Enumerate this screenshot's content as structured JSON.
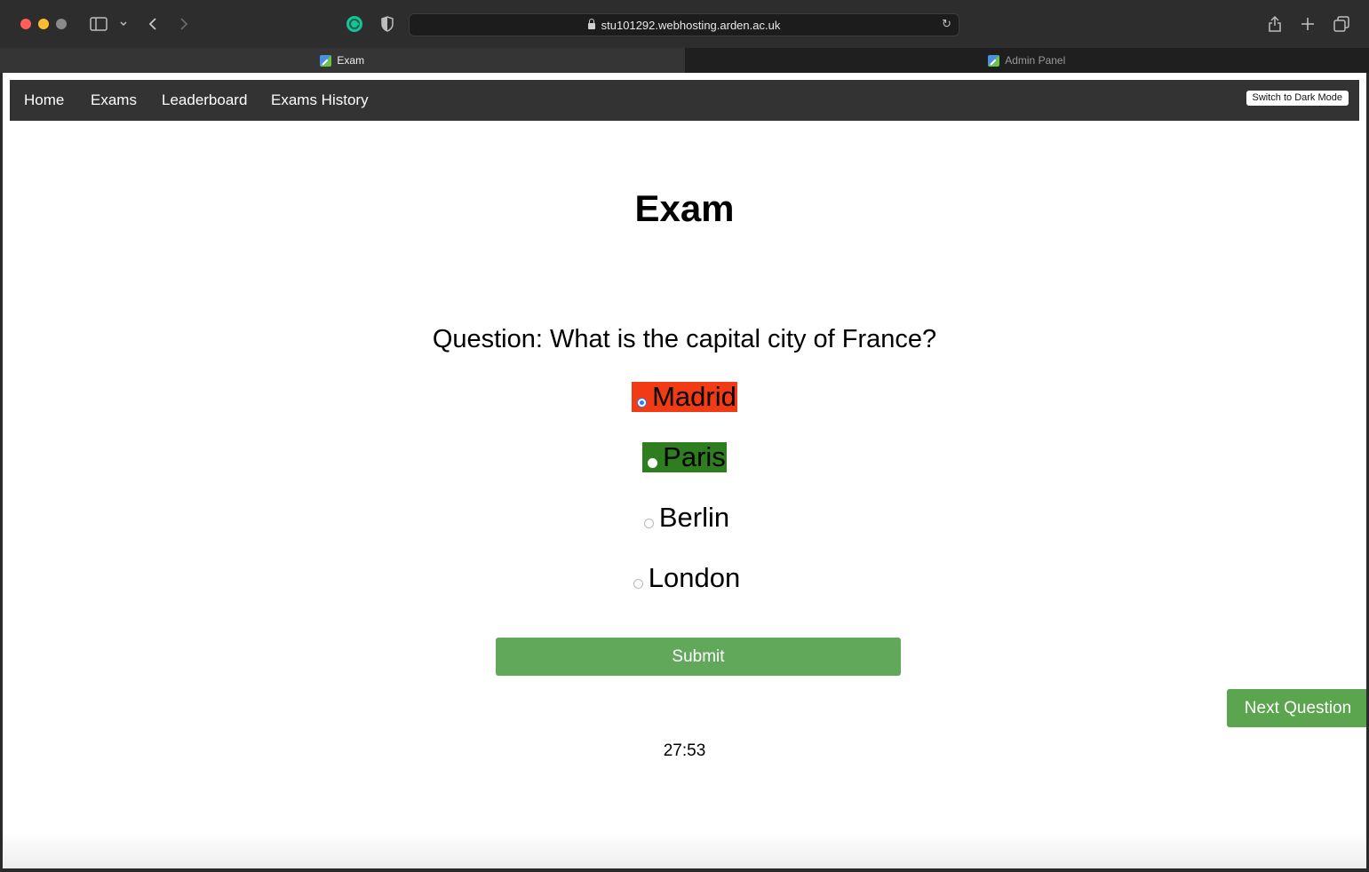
{
  "browser": {
    "url": "stu101292.webhosting.arden.ac.uk",
    "tabs": [
      {
        "label": "Exam",
        "active": true
      },
      {
        "label": "Admin Panel",
        "active": false
      }
    ]
  },
  "nav": {
    "links": [
      "Home",
      "Exams",
      "Leaderboard",
      "Exams History"
    ],
    "dark_mode_label": "Switch to Dark Mode",
    "background": "#333333"
  },
  "exam": {
    "title": "Exam",
    "question": "Question: What is the capital city of France?",
    "options": [
      {
        "label": "Madrid",
        "state": "selected-wrong",
        "color": "#f23a14"
      },
      {
        "label": "Paris",
        "state": "correct",
        "color": "#2e7d1e"
      },
      {
        "label": "Berlin",
        "state": "none"
      },
      {
        "label": "London",
        "state": "none"
      }
    ],
    "submit_label": "Submit",
    "next_label": "Next Question",
    "timer": "27:53",
    "button_color": "#62a85a"
  },
  "icons": [
    "sidebar-icon",
    "chevron-down-icon",
    "back-icon",
    "forward-icon",
    "grammarly-icon",
    "shield-icon",
    "lock-icon",
    "reload-icon",
    "share-icon",
    "plus-icon",
    "tabs-overview-icon"
  ]
}
